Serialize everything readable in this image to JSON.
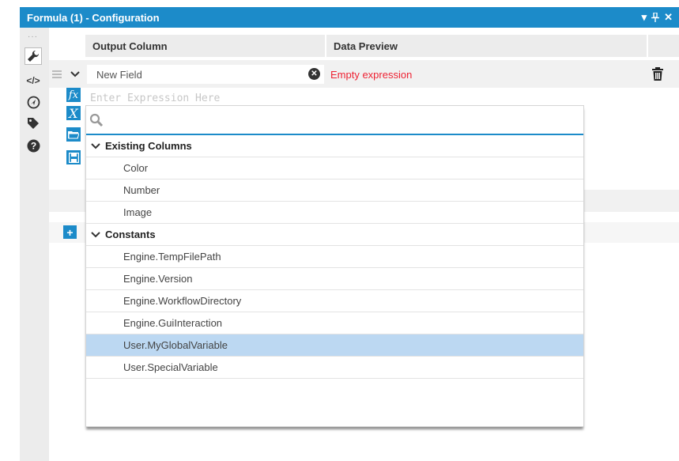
{
  "window": {
    "title": "Formula (1) - Configuration",
    "controls": {
      "menu": "▾",
      "pin": "⊥",
      "close": "✕"
    }
  },
  "sidebar": {
    "dots": "···",
    "icons": [
      "wrench-icon",
      "code-icon",
      "navigate-icon",
      "tag-icon",
      "help-icon"
    ]
  },
  "table": {
    "headers": {
      "output_column": "Output Column",
      "data_preview": "Data Preview"
    },
    "row": {
      "field_placeholder": "New Field",
      "preview": "Empty expression"
    }
  },
  "expression": {
    "placeholder": "Enter Expression Here",
    "tools": [
      "fx",
      "X"
    ]
  },
  "popup": {
    "search_placeholder": "",
    "groups": [
      {
        "label": "Existing Columns",
        "items": [
          "Color",
          "Number",
          "Image"
        ]
      },
      {
        "label": "Constants",
        "items": [
          "Engine.TempFilePath",
          "Engine.Version",
          "Engine.WorkflowDirectory",
          "Engine.GuiInteraction",
          "User.MyGlobalVariable",
          "User.SpecialVariable"
        ]
      }
    ],
    "selected_item": "User.MyGlobalVariable"
  },
  "colors": {
    "accent": "#1c8bc9",
    "error": "#e22233",
    "selection": "#bcd8f2"
  }
}
